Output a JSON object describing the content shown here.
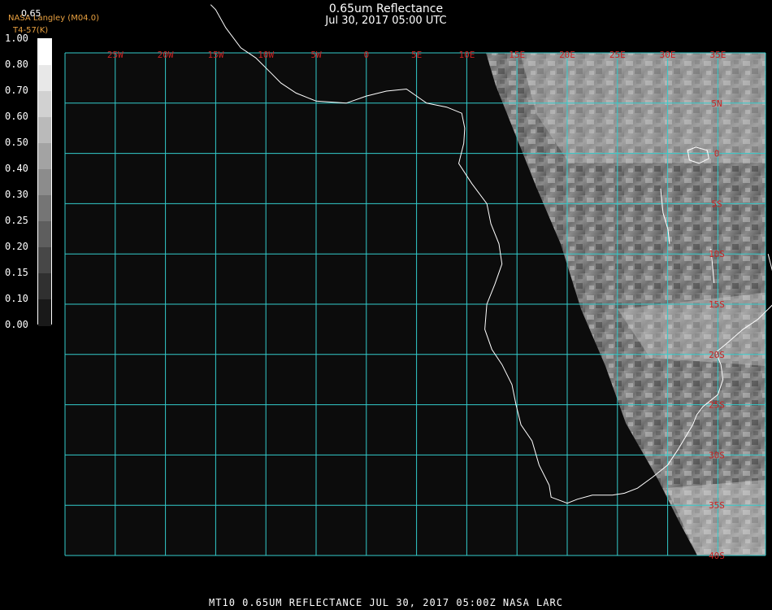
{
  "title": "0.65um Reflectance",
  "subtitle": "Jul 30, 2017 05:00 UTC",
  "credit_line1": "NASA Langley (M04.0)",
  "credit_line2": "T4-57(K)",
  "colorbar_value": "0.65",
  "colorbar_ticks": [
    "1.00",
    "0.80",
    "0.70",
    "0.60",
    "0.50",
    "0.40",
    "0.30",
    "0.25",
    "0.20",
    "0.15",
    "0.10",
    "0.00"
  ],
  "lon_labels": [
    "25W",
    "20W",
    "15W",
    "10W",
    "5W",
    "0",
    "5E",
    "10E",
    "15E",
    "20E",
    "25E",
    "30E",
    "35E"
  ],
  "lat_labels": [
    "5N",
    "0",
    "5S",
    "10S",
    "15S",
    "20S",
    "25S",
    "30S",
    "35S",
    "40S"
  ],
  "footer": "MT10  0.65UM REFLECTANCE   JUL 30, 2017 05:00Z   NASA LARC",
  "colors": {
    "grid": "#33cccc",
    "label": "#cc2222",
    "coast": "#ffffff",
    "background": "#0c0c0c"
  }
}
